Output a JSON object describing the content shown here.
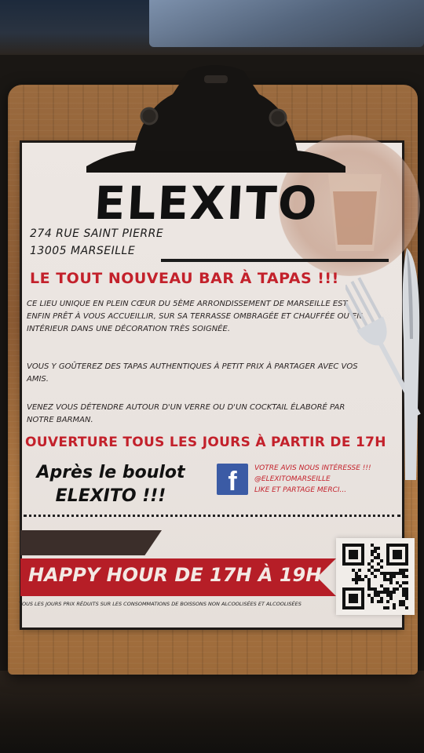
{
  "menu": {
    "name": "ELEXITO",
    "address_line1": "274 RUE SAINT PIERRE",
    "address_line2": "13005 MARSEILLE",
    "headline": "LE TOUT NOUVEAU BAR À TAPAS !!!",
    "paragraph1": "Ce lieu unique en plein cœur du 5ème arrondissement de Marseille est enfin prêt à vous accueillir, sur sa terrasse ombragée et chauffée ou en intérieur dans une décoration très soignée.",
    "paragraph2": "Vous y goûterez des tapas authentiques à petit prix à partager avec vos amis.",
    "paragraph3": "Venez vous détendre autour d'un verre ou d'un cocktail élaboré par notre barman.",
    "opening": "OUVERTURE TOUS LES JOURS À PARTIR DE 17H",
    "slogan_line1": "Après le boulot",
    "slogan_line2": "ELEXITO !!!",
    "facebook_glyph": "f",
    "facebook_line1": "VOTRE AVIS NOUS INTÉRESSE !!!",
    "facebook_line2": "@ELEXITOMARSEILLE",
    "facebook_line3": "LIKE ET PARTAGE MERCI...",
    "happy_hour": "HAPPY HOUR DE 17H À 19H",
    "fine_print": "TOUS LES JOURS PRIX RÉDUITS SUR LES CONSOMMATIONS DE BOISSONS NON ALCOOLISÉES ET ALCOOLISÉES"
  },
  "colors": {
    "accent_red": "#c3212b",
    "banner_red": "#b61e27",
    "facebook_blue": "#3b5ba5",
    "paper": "#ebe5e1",
    "wood": "#9a6a3e"
  },
  "icons": [
    "clipboard-clip-icon",
    "beer-glass-icon",
    "fork-icon",
    "knife-icon",
    "facebook-icon",
    "qr-code-icon"
  ]
}
